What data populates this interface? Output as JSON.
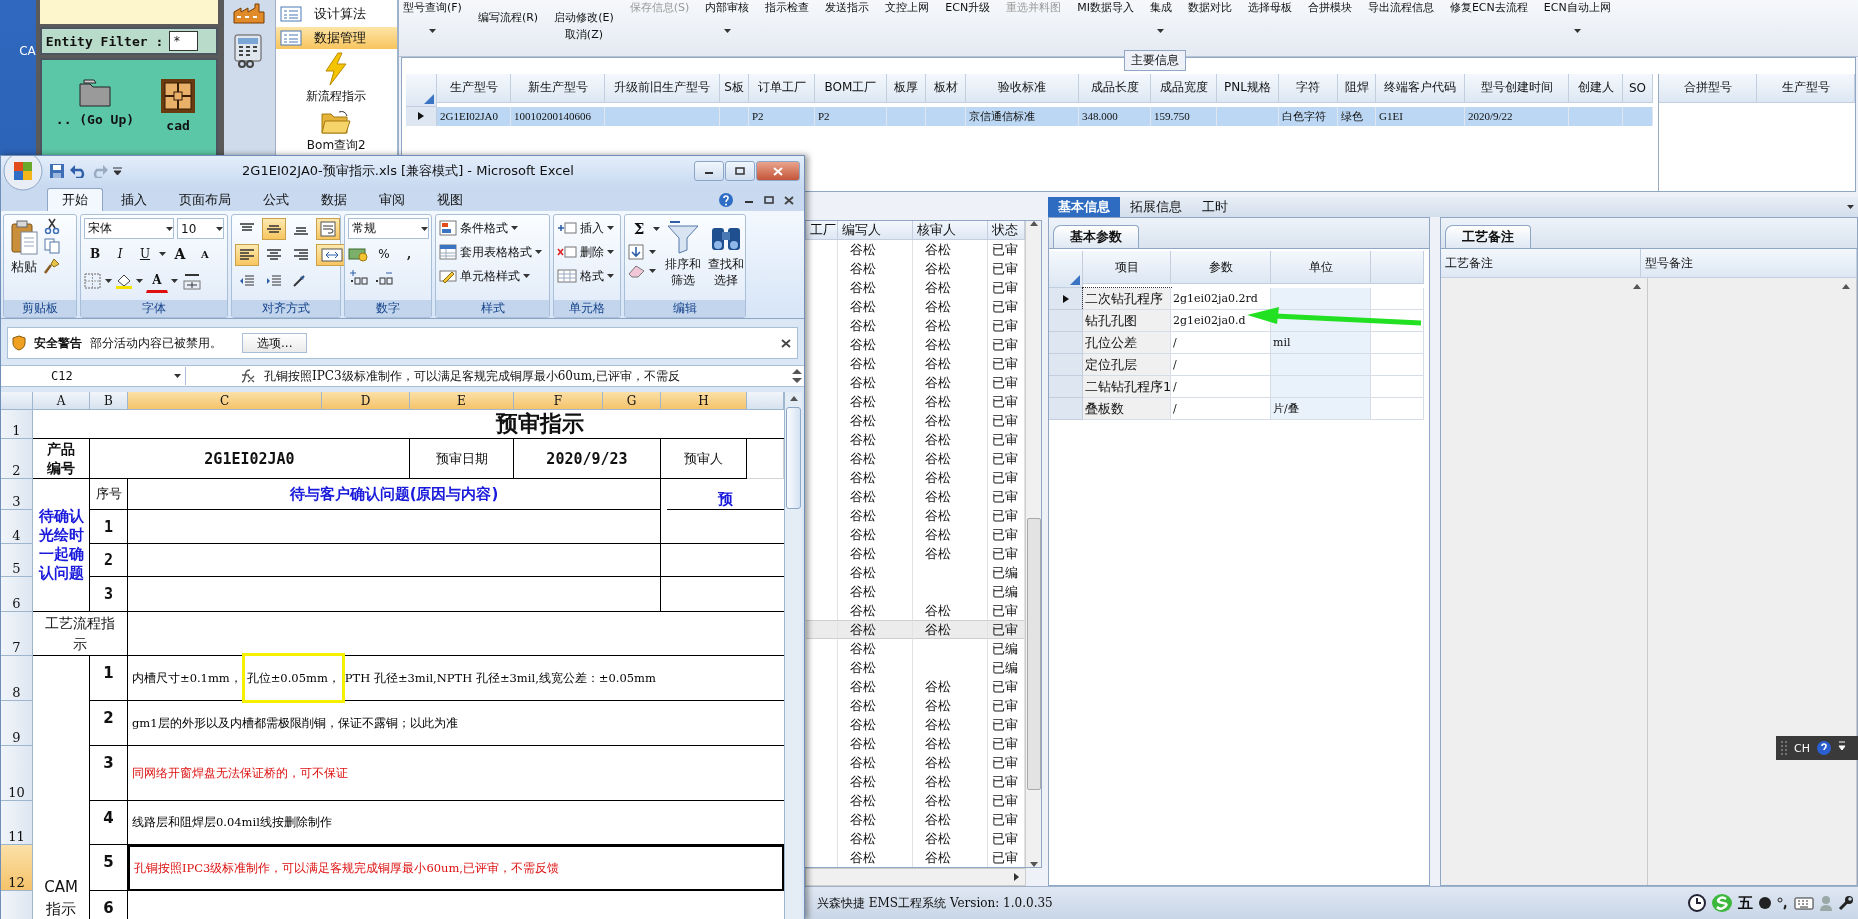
{
  "desktop": {
    "label": "CA"
  },
  "file_browser": {
    "filter_label": "Entity Filter :",
    "filter_value": "*",
    "items": [
      {
        "kind": "folder",
        "label": ".. (Go Up)"
      },
      {
        "kind": "grid",
        "label": "cad"
      }
    ]
  },
  "launcher": [
    {
      "kind": "factory"
    },
    {
      "kind": "calculator"
    }
  ],
  "nav": [
    {
      "label": "设计算法",
      "kind": "list",
      "selected": false
    },
    {
      "label": "数据管理",
      "kind": "list",
      "selected": true
    },
    {
      "label": "新流程指示",
      "kind": "bolt",
      "selected": false
    },
    {
      "label": "Bom查询2",
      "kind": "folder",
      "selected": false
    }
  ],
  "toolbar": [
    {
      "label": "型号查询(F)",
      "dropdown": true,
      "disabled": false
    },
    {
      "label": "编写流程(R)",
      "dropdown": false,
      "disabled": false
    },
    {
      "label": "启动修改(E)",
      "second_label": "取消(Z)",
      "dropdown": false,
      "disabled": false
    },
    {
      "label": "保存信息(S)",
      "dropdown": false,
      "disabled": true
    },
    {
      "label": "内部审核",
      "dropdown": true,
      "disabled": false
    },
    {
      "label": "指示检查",
      "dropdown": false,
      "disabled": false
    },
    {
      "label": "发送指示",
      "dropdown": false,
      "disabled": false
    },
    {
      "label": "文控上网",
      "dropdown": false,
      "disabled": false
    },
    {
      "label": "ECN升级",
      "dropdown": false,
      "disabled": false
    },
    {
      "label": "重选并料图",
      "dropdown": false,
      "disabled": true
    },
    {
      "label": "MI数据导入",
      "dropdown": false,
      "disabled": false
    },
    {
      "label": "集成",
      "dropdown": true,
      "disabled": false
    },
    {
      "label": "数据对比",
      "dropdown": false,
      "disabled": false
    },
    {
      "label": "选择母板",
      "dropdown": false,
      "disabled": false
    },
    {
      "label": "合拼模块",
      "dropdown": false,
      "disabled": false
    },
    {
      "label": "导出流程信息",
      "dropdown": false,
      "disabled": false
    },
    {
      "label": "修复ECN去流程",
      "dropdown": false,
      "disabled": false
    },
    {
      "label": "ECN自动上网",
      "dropdown": true,
      "disabled": false
    }
  ],
  "main_info": {
    "title": "主要信息",
    "columns": [
      "生产型号",
      "新生产型号",
      "升级前旧生产型号",
      "S板",
      "订单工厂",
      "BOM工厂",
      "板厚",
      "板材",
      "验收标准",
      "成品长度",
      "成品宽度",
      "PNL规格",
      "字符",
      "阻焊",
      "终端客户代码",
      "型号创建时间",
      "创建人",
      "SO"
    ],
    "rows": [
      {
        "selected": true,
        "cells": [
          "2G1EI02JA0",
          "10010200140606",
          null,
          null,
          "P2",
          "P2",
          null,
          null,
          "京信通信标准",
          "348.000",
          "159.750",
          null,
          "白色字符",
          "绿色",
          "G1EI",
          "2020/9/22",
          null,
          null
        ]
      }
    ]
  },
  "merge_grid": {
    "columns": [
      "合拼型号",
      "生产型号"
    ]
  },
  "record_list": {
    "columns": [
      "工厂",
      "编写人",
      "核审人",
      "状态"
    ],
    "rows": [
      {
        "cells": [
          null,
          "谷松",
          "谷松",
          "已审"
        ],
        "selected": false
      },
      {
        "cells": [
          null,
          "谷松",
          "谷松",
          "已审"
        ],
        "selected": false
      },
      {
        "cells": [
          null,
          "谷松",
          "谷松",
          "已审"
        ],
        "selected": false
      },
      {
        "cells": [
          null,
          "谷松",
          "谷松",
          "已审"
        ],
        "selected": false
      },
      {
        "cells": [
          null,
          "谷松",
          "谷松",
          "已审"
        ],
        "selected": false
      },
      {
        "cells": [
          null,
          "谷松",
          "谷松",
          "已审"
        ],
        "selected": false
      },
      {
        "cells": [
          null,
          "谷松",
          "谷松",
          "已审"
        ],
        "selected": false
      },
      {
        "cells": [
          null,
          "谷松",
          "谷松",
          "已审"
        ],
        "selected": false
      },
      {
        "cells": [
          null,
          "谷松",
          "谷松",
          "已审"
        ],
        "selected": false
      },
      {
        "cells": [
          null,
          "谷松",
          "谷松",
          "已审"
        ],
        "selected": false
      },
      {
        "cells": [
          null,
          "谷松",
          "谷松",
          "已审"
        ],
        "selected": false
      },
      {
        "cells": [
          null,
          "谷松",
          "谷松",
          "已审"
        ],
        "selected": false
      },
      {
        "cells": [
          null,
          "谷松",
          "谷松",
          "已审"
        ],
        "selected": false
      },
      {
        "cells": [
          null,
          "谷松",
          "谷松",
          "已审"
        ],
        "selected": false
      },
      {
        "cells": [
          null,
          "谷松",
          "谷松",
          "已审"
        ],
        "selected": false
      },
      {
        "cells": [
          null,
          "谷松",
          "谷松",
          "已审"
        ],
        "selected": false
      },
      {
        "cells": [
          null,
          "谷松",
          "谷松",
          "已审"
        ],
        "selected": false
      },
      {
        "cells": [
          null,
          "谷松",
          null,
          "已编"
        ],
        "selected": false
      },
      {
        "cells": [
          null,
          "谷松",
          null,
          "已编"
        ],
        "selected": false
      },
      {
        "cells": [
          null,
          "谷松",
          "谷松",
          "已审"
        ],
        "selected": false
      },
      {
        "cells": [
          null,
          "谷松",
          "谷松",
          "已审"
        ],
        "selected": true
      },
      {
        "cells": [
          null,
          "谷松",
          null,
          "已编"
        ],
        "selected": false
      },
      {
        "cells": [
          null,
          "谷松",
          null,
          "已编"
        ],
        "selected": false
      },
      {
        "cells": [
          null,
          "谷松",
          "谷松",
          "已审"
        ],
        "selected": false
      },
      {
        "cells": [
          null,
          "谷松",
          "谷松",
          "已审"
        ],
        "selected": false
      },
      {
        "cells": [
          null,
          "谷松",
          "谷松",
          "已审"
        ],
        "selected": false
      },
      {
        "cells": [
          null,
          "谷松",
          "谷松",
          "已审"
        ],
        "selected": false
      },
      {
        "cells": [
          null,
          "谷松",
          "谷松",
          "已审"
        ],
        "selected": false
      },
      {
        "cells": [
          null,
          "谷松",
          "谷松",
          "已审"
        ],
        "selected": false
      },
      {
        "cells": [
          null,
          "谷松",
          "谷松",
          "已审"
        ],
        "selected": false
      },
      {
        "cells": [
          null,
          "谷松",
          "谷松",
          "已审"
        ],
        "selected": false
      },
      {
        "cells": [
          null,
          "谷松",
          "谷松",
          "已审"
        ],
        "selected": false
      },
      {
        "cells": [
          null,
          "谷松",
          "谷松",
          "已审"
        ],
        "selected": false
      }
    ]
  },
  "detail_tabs": [
    {
      "label": "基本信息",
      "selected": true
    },
    {
      "label": "拓展信息",
      "selected": false
    },
    {
      "label": "工时",
      "selected": false
    }
  ],
  "params": {
    "tab": "基本参数",
    "columns": [
      "项目",
      "参数",
      "单位"
    ],
    "rows": [
      {
        "cells": [
          "二次钻孔程序",
          "2g1ei02ja0.2rd",
          null
        ],
        "selected": true
      },
      {
        "cells": [
          "钻孔孔图",
          "2g1ei02ja0.d",
          null
        ],
        "selected": false
      },
      {
        "cells": [
          "孔位公差",
          "/",
          "mil"
        ],
        "selected": false
      },
      {
        "cells": [
          "定位孔层",
          "/",
          null
        ],
        "selected": false
      },
      {
        "cells": [
          "二钻钻孔程序1",
          "/",
          null
        ],
        "selected": false
      },
      {
        "cells": [
          "叠板数",
          "/",
          "片/叠"
        ],
        "selected": false
      }
    ],
    "annotations": [
      {
        "kind": "arrow",
        "color": "#22e022"
      }
    ]
  },
  "notes": {
    "tab": "工艺备注",
    "columns": [
      "工艺备注",
      "型号备注"
    ]
  },
  "status_bar": {
    "text": "兴森快捷 EMS工程系统 Version: 1.0.0.35",
    "ime": "五"
  },
  "language_bar": {
    "label": "CH"
  },
  "excel": {
    "title": "2G1EI02JA0-预审指示.xls  [兼容模式] - Microsoft Excel",
    "tabs": [
      {
        "label": "开始",
        "selected": true
      },
      {
        "label": "插入",
        "selected": false
      },
      {
        "label": "页面布局",
        "selected": false
      },
      {
        "label": "公式",
        "selected": false
      },
      {
        "label": "数据",
        "selected": false
      },
      {
        "label": "审阅",
        "selected": false
      },
      {
        "label": "视图",
        "selected": false
      }
    ],
    "ribbon": {
      "clipboard": {
        "paste": "粘贴",
        "label": "剪贴板"
      },
      "font": {
        "face": "宋体",
        "size": "10",
        "bold": "B",
        "italic": "I",
        "underline": "U",
        "grow": "A",
        "shrink": "A",
        "text_color_letter": "A",
        "label": "字体"
      },
      "alignment": {
        "label": "对齐方式",
        "buttons": [
          {
            "kind": "top",
            "selected": false
          },
          {
            "kind": "middle",
            "selected": true
          },
          {
            "kind": "bottom",
            "selected": false
          },
          {
            "kind": "wrap",
            "selected": true
          },
          {
            "kind": "left",
            "selected": true
          },
          {
            "kind": "center",
            "selected": false
          },
          {
            "kind": "right",
            "selected": false
          },
          {
            "kind": "merge",
            "selected": true
          },
          {
            "kind": "outdent",
            "selected": false
          },
          {
            "kind": "indent",
            "selected": false
          },
          {
            "kind": "orientation",
            "selected": false
          }
        ]
      },
      "number": {
        "format": "常规",
        "percent": "%",
        "comma": ",",
        "label": "数字"
      },
      "styles": {
        "items": [
          "条件格式",
          "套用表格格式",
          "单元格样式"
        ],
        "label": "样式"
      },
      "cells": {
        "items": [
          "插入",
          "删除",
          "格式"
        ],
        "label": "单元格"
      },
      "editing": {
        "sum": "Σ",
        "sort": "排序和筛选",
        "find": "查找和选择",
        "label": "编辑"
      }
    },
    "security": {
      "title": "安全警告",
      "message": "部分活动内容已被禁用。",
      "button": "选项..."
    },
    "name_box": "C12",
    "formula": "孔铜按照IPC3级标准制作，可以满足客规完成铜厚最小60um,已评审，不需反",
    "sheet": {
      "columns": [
        {
          "label": "A",
          "selected": false
        },
        {
          "label": "B",
          "selected": false
        },
        {
          "label": "C",
          "selected": true
        },
        {
          "label": "D",
          "selected": true
        },
        {
          "label": "E",
          "selected": true
        },
        {
          "label": "F",
          "selected": true
        },
        {
          "label": "G",
          "selected": true
        },
        {
          "label": "H",
          "selected": true
        }
      ],
      "rows": [
        {
          "label": "1",
          "selected": false
        },
        {
          "label": "2",
          "selected": false
        },
        {
          "label": "3",
          "selected": false
        },
        {
          "label": "4",
          "selected": false
        },
        {
          "label": "5",
          "selected": false
        },
        {
          "label": "6",
          "selected": false
        },
        {
          "label": "7",
          "selected": false
        },
        {
          "label": "8",
          "selected": false
        },
        {
          "label": "9",
          "selected": false
        },
        {
          "label": "10",
          "selected": false
        },
        {
          "label": "11",
          "selected": false
        },
        {
          "label": "12",
          "selected": true
        }
      ],
      "title": "预审指示",
      "product_label": "产品编号",
      "product_code": "2G1EI02JA0",
      "date_label": "预审日期",
      "date": "2020/9/23",
      "reviewer_label": "预审人",
      "pending_label": "待确认光绘时一起确认问题",
      "seq_header": "序号",
      "question_header": "待与客户确认问题(原因与内容)",
      "right_header": "预",
      "pending_items": [
        "1",
        "2",
        "3"
      ],
      "flow_label": "工艺流程指示",
      "cam_label": "CAM指示",
      "cam_items": [
        {
          "number": "1",
          "color": "#000000",
          "selected": false,
          "segments": [
            {
              "text": "内槽尺寸±0.1mm，",
              "boxed": false
            },
            {
              "text": "孔位±0.05mm，",
              "boxed": true
            },
            {
              "text": "PTH 孔径±3mil,NPTH 孔径±3mil,线宽公差：±0.05mm",
              "boxed": false
            }
          ]
        },
        {
          "number": "2",
          "color": "#000000",
          "selected": false,
          "text": "gm1层的外形以及内槽都需极限削铜，保证不露铜；以此为准"
        },
        {
          "number": "3",
          "color": "#dd1111",
          "selected": false,
          "text": "同网络开窗焊盘无法保证桥的，可不保证"
        },
        {
          "number": "4",
          "color": "#000000",
          "selected": false,
          "text": "线路层和阻焊层0.04mil线按删除制作"
        },
        {
          "number": "5",
          "color": "#dd1111",
          "selected": true,
          "text": "孔铜按照IPC3级标准制作，可以满足客规完成铜厚最小60um,已评审，不需反馈"
        },
        {
          "number": "6",
          "selected": false
        }
      ]
    }
  }
}
